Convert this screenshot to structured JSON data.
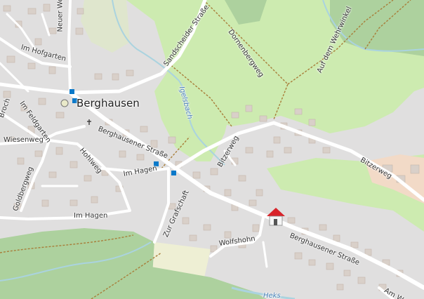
{
  "map": {
    "place": "Berghausen",
    "streets": {
      "neuer_weg": "Neuer Weg",
      "im_hofgarten": "Im Hofgarten",
      "broch": "Broch",
      "im_feldgarten": "Im Feldgarten",
      "wiesenweg": "Wiesenweg",
      "hohlweg": "Hohlweg",
      "berghausener_strasse_1": "Berghausener Straße",
      "berghausener_strasse_2": "Berghausener Straße",
      "im_hagen_1": "Im Hagen",
      "im_hagen_2": "Im Hagen",
      "goldbergweg": "Goldbergweg",
      "zur_grafschaft": "Zur Grafschaft",
      "bitzerweg_1": "Bitzerweg",
      "bitzerweg_2": "Bitzerweg",
      "wolfshohn": "Wolfshohn",
      "sandscheider_strasse": "Sandscheider Straße",
      "dornenbergweg": "Dornenbergweg",
      "auf_dem_wehrwinkel": "Auf dem Wehrwinkel",
      "am_w": "Am W"
    },
    "waterways": {
      "igelsbach": "Igelsbach",
      "heks": "Heks"
    },
    "colors": {
      "residential": "#e0dfdf",
      "meadow": "#cdebb0",
      "forest": "#add19e",
      "building": "#d9d0c9",
      "road": "#ffffff",
      "water": "#aad3df",
      "track": "#a87e3a",
      "industrial": "#f2dac7",
      "bus_stop": "#0b79c9"
    }
  }
}
